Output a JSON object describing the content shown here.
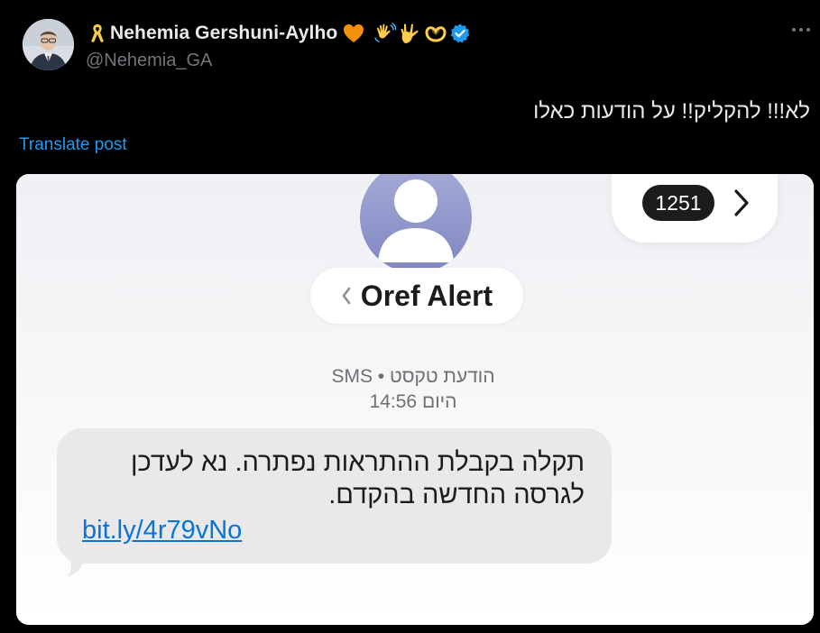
{
  "tweet": {
    "author_name": "Nehemia Gershuni-Aylho",
    "handle": "@Nehemia_GA",
    "text": "לא!!! להקליק!! על הודעות כאלו",
    "translate_label": "Translate post",
    "name_icons": [
      "yellow-ribbon-icon",
      "orange-heart-icon",
      "waving-hand-icon",
      "love-you-gesture-icon",
      "heart-hands-icon",
      "verified-badge-icon"
    ]
  },
  "screenshot": {
    "unread_count": "1251",
    "contact_name": "Oref Alert",
    "message_type": "הודעת טקסט • SMS",
    "timestamp": "היום 14:56",
    "message_line_1": "תקלה בקבלת ההתראות נפתרה. נא לעדכן",
    "message_line_2": "לגרסה החדשה בהקדם.",
    "message_link": "bit.ly/4r79vNo"
  },
  "colors": {
    "background": "#000000",
    "link_blue": "#1d9bf0",
    "verified_blue": "#1d9bf0",
    "bubble_gray": "#e9e9eb",
    "sms_link": "#0b72d6"
  }
}
